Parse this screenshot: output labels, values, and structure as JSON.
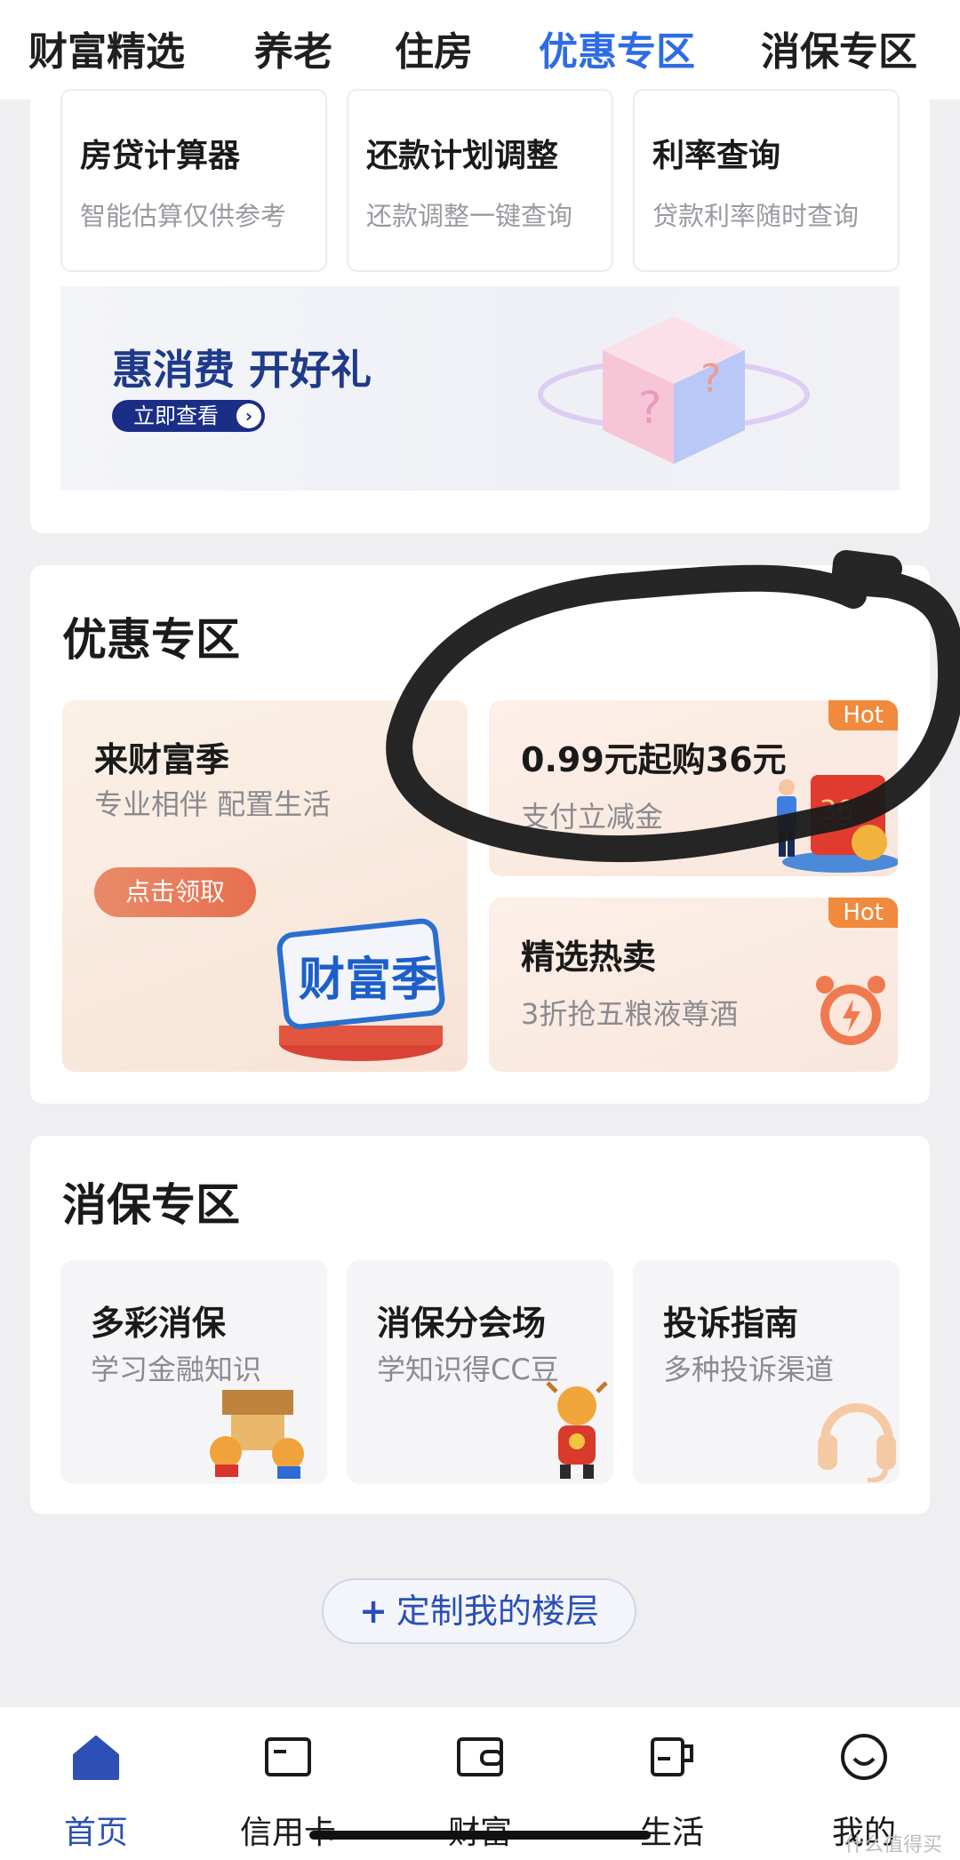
{
  "top_tabs": [
    "财富精选",
    "养老",
    "住房",
    "优惠专区",
    "消保专区"
  ],
  "active_tab_index": 3,
  "tools": [
    {
      "title": "房贷计算器",
      "subtitle": "智能估算仅供参考"
    },
    {
      "title": "还款计划调整",
      "subtitle": "还款调整一键查询"
    },
    {
      "title": "利率查询",
      "subtitle": "贷款利率随时查询"
    }
  ],
  "banner": {
    "title": "惠消费 开好礼",
    "button": "立即查看"
  },
  "promo_section": {
    "title": "优惠专区",
    "left_card": {
      "title": "来财富季",
      "subtitle": "专业相伴 配置生活",
      "button": "点击领取",
      "art_text": "财富季"
    },
    "right_top": {
      "title": "0.99元起购36元",
      "subtitle": "支付立减金",
      "badge": "Hot",
      "art_text": "36"
    },
    "right_bottom": {
      "title": "精选热卖",
      "subtitle": "3折抢五粮液尊酒",
      "badge": "Hot"
    }
  },
  "consumer_section": {
    "title": "消保专区",
    "cards": [
      {
        "title": "多彩消保",
        "subtitle": "学习金融知识"
      },
      {
        "title": "消保分会场",
        "subtitle": "学知识得CC豆"
      },
      {
        "title": "投诉指南",
        "subtitle": "多种投诉渠道"
      }
    ]
  },
  "custom_floor": {
    "icon": "plus-icon",
    "label": "定制我的楼层"
  },
  "bottom_nav": [
    {
      "label": "首页",
      "icon": "home-icon",
      "active": true
    },
    {
      "label": "信用卡",
      "icon": "credit-card-icon",
      "active": false
    },
    {
      "label": "财富",
      "icon": "wallet-icon",
      "active": false
    },
    {
      "label": "生活",
      "icon": "cup-icon",
      "active": false
    },
    {
      "label": "我的",
      "icon": "smile-icon",
      "active": false
    }
  ],
  "watermark": "什么值得买",
  "colors": {
    "accent": "#2e6be6",
    "nav_active": "#2e4fb6",
    "hot": "#f08a3c",
    "banner_title": "#1e3a8a"
  }
}
